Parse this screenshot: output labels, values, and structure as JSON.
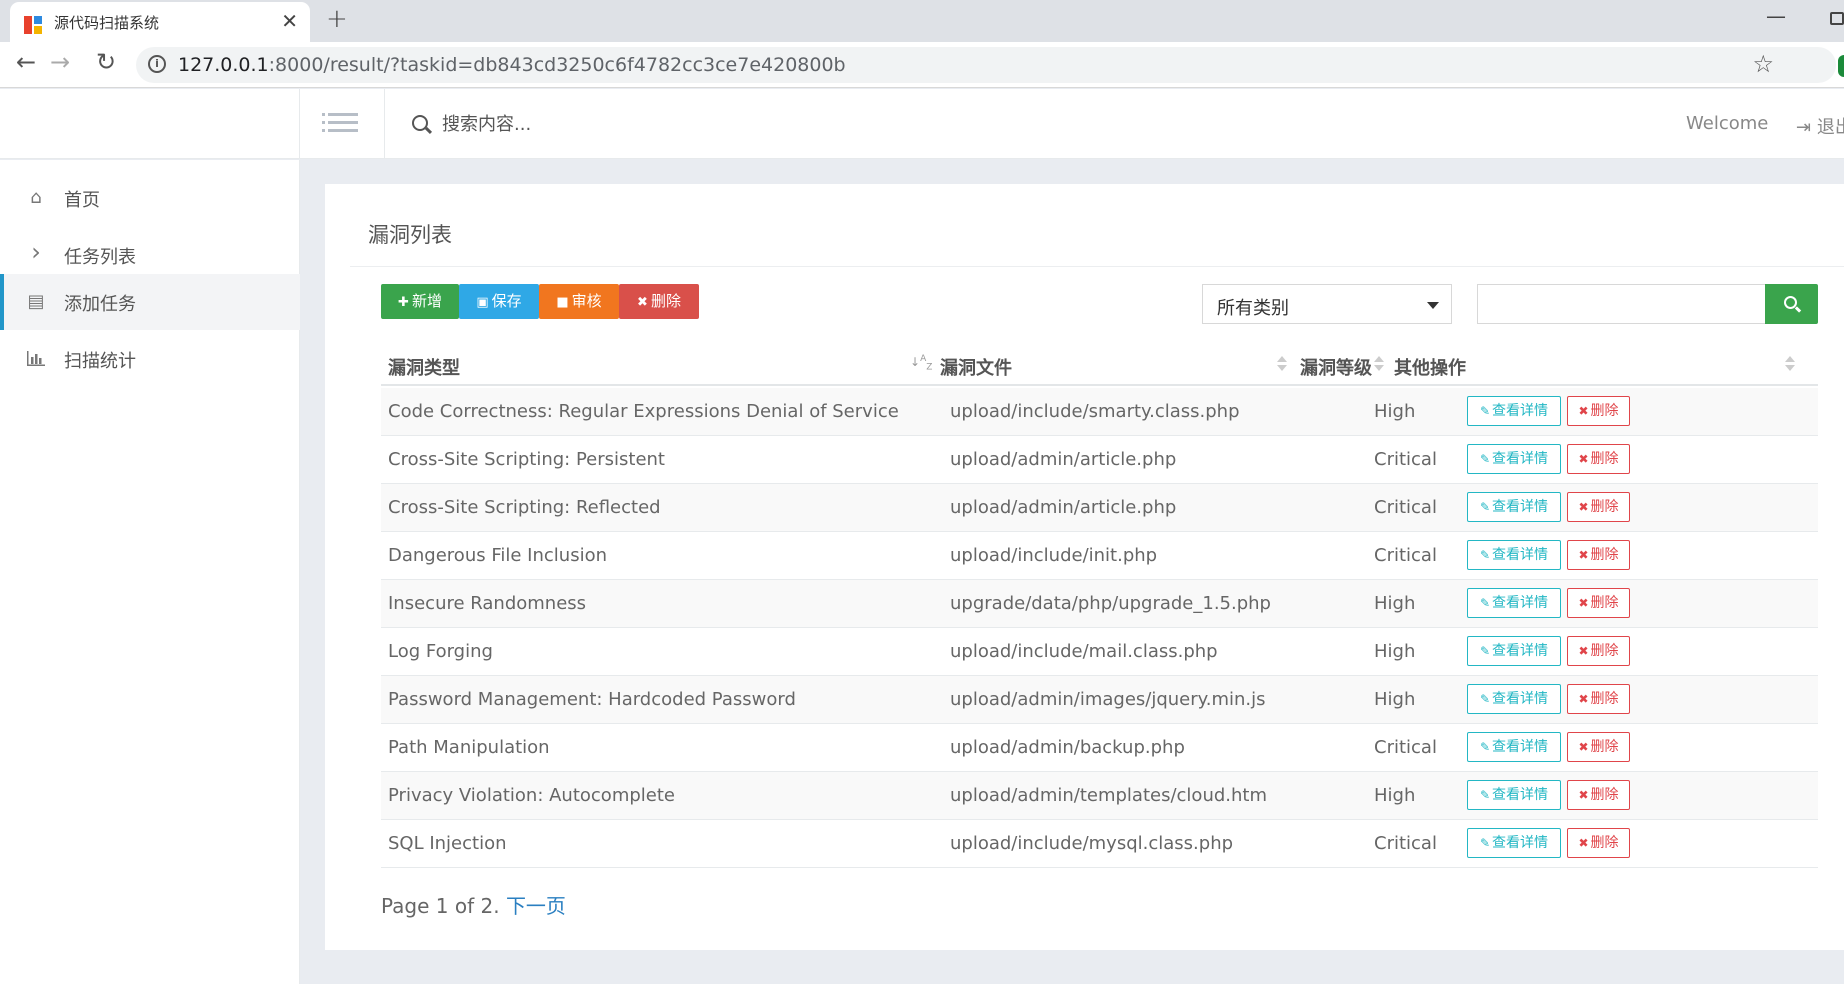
{
  "browser": {
    "tab_title": "源代码扫描系统",
    "tab_close": "✕",
    "new_tab": "+",
    "url_host": "127.0.0.1",
    "url_rest": ":8000/result/?taskid=db843cd3250c6f4782cc3ce7e420800b",
    "back": "←",
    "forward": "→",
    "reload": "↻",
    "star": "☆",
    "minimize": "—",
    "info_glyph": "i"
  },
  "header": {
    "search_placeholder": "搜索内容...",
    "welcome": "Welcome",
    "logout": "退出",
    "logout_glyph": "⇥"
  },
  "sidebar": {
    "items": [
      {
        "label": "首页",
        "icon": "home-icon",
        "glyph": "⌂"
      },
      {
        "label": "任务列表",
        "icon": "chevron-right-icon",
        "glyph": "›"
      },
      {
        "label": "添加任务",
        "icon": "list-alt-icon",
        "glyph": "▤",
        "active": true
      },
      {
        "label": "扫描统计",
        "icon": "bar-chart-icon",
        "glyph": "▮"
      }
    ]
  },
  "panel": {
    "title": "漏洞列表",
    "buttons": {
      "add": {
        "label": "新增",
        "glyph": "✚"
      },
      "save": {
        "label": "保存",
        "glyph": "▣"
      },
      "audit": {
        "label": "审核",
        "glyph": "■"
      },
      "delete": {
        "label": "删除",
        "glyph": "✖"
      }
    },
    "category_select": "所有类别",
    "filter_value": "",
    "columns": [
      "漏洞类型",
      "漏洞文件",
      "漏洞等级",
      "其他操作"
    ],
    "sort_az": "A\nZ",
    "row_actions": {
      "view": "查看详情",
      "view_glyph": "✎",
      "delete": "删除",
      "delete_glyph": "✖"
    },
    "rows": [
      {
        "type": "Code Correctness: Regular Expressions Denial of Service",
        "file": "upload/include/smarty.class.php",
        "level": "High"
      },
      {
        "type": "Cross-Site Scripting: Persistent",
        "file": "upload/admin/article.php",
        "level": "Critical"
      },
      {
        "type": "Cross-Site Scripting: Reflected",
        "file": "upload/admin/article.php",
        "level": "Critical"
      },
      {
        "type": "Dangerous File Inclusion",
        "file": "upload/include/init.php",
        "level": "Critical"
      },
      {
        "type": "Insecure Randomness",
        "file": "upgrade/data/php/upgrade_1.5.php",
        "level": "High"
      },
      {
        "type": "Log Forging",
        "file": "upload/include/mail.class.php",
        "level": "High"
      },
      {
        "type": "Password Management: Hardcoded Password",
        "file": "upload/admin/images/jquery.min.js",
        "level": "High"
      },
      {
        "type": "Path Manipulation",
        "file": "upload/admin/backup.php",
        "level": "Critical"
      },
      {
        "type": "Privacy Violation: Autocomplete",
        "file": "upload/admin/templates/cloud.htm",
        "level": "High"
      },
      {
        "type": "SQL Injection",
        "file": "upload/include/mysql.class.php",
        "level": "Critical"
      }
    ],
    "pager": {
      "text": "Page 1 of 2. ",
      "next": "下一页"
    }
  },
  "colors": {
    "green": "#3aa44c",
    "blue": "#2fa8e6",
    "orange": "#f1761f",
    "red": "#d9504a",
    "teal": "#23b7c4",
    "active_bar": "#2196c9"
  }
}
